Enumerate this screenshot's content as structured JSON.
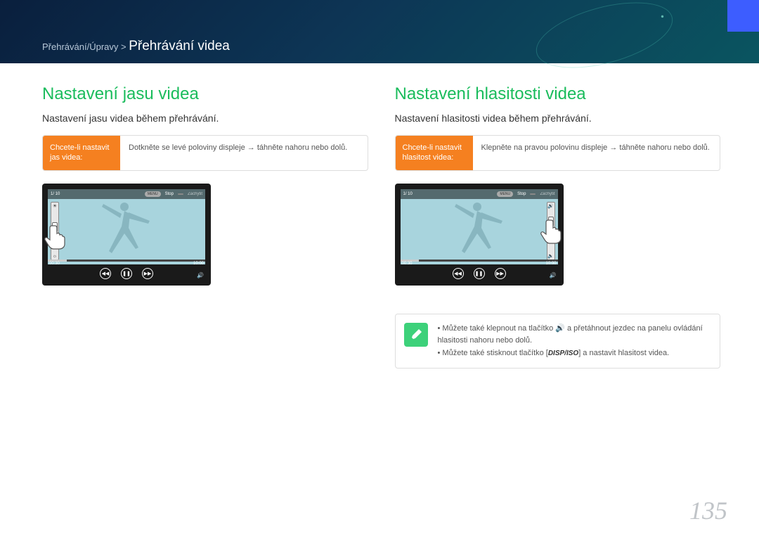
{
  "header": {
    "breadcrumb_parent": "Přehrávání/Úpravy > ",
    "breadcrumb_current": "Přehrávání videa"
  },
  "left": {
    "title": "Nastavení jasu videa",
    "subtitle": "Nastavení jasu videa během přehrávání.",
    "instr_label": "Chcete-li nastavit jas videa:",
    "instr_text": "Dotkněte se levé poloviny displeje → táhněte nahoru nebo dolů.",
    "device": {
      "counter": "1/ 10",
      "menu_btn": "MENU",
      "stop_label": "Stop",
      "capture_label": "Zachytit",
      "time_start": "00:30",
      "time_end": "10:00"
    }
  },
  "right": {
    "title": "Nastavení hlasitosti videa",
    "subtitle": "Nastavení hlasitosti videa během přehrávání.",
    "instr_label": "Chcete-li nastavit hlasitost videa:",
    "instr_text": "Klepněte na pravou polovinu displeje → táhněte nahoru nebo dolů.",
    "device": {
      "counter": "1/ 10",
      "menu_btn": "MENU",
      "stop_label": "Stop",
      "capture_label": "Zachytit",
      "time_start": "00:30",
      "time_end": "10:00"
    },
    "tips": {
      "line1_pre": "Můžete také klepnout na tlačítko ",
      "line1_post": " a přetáhnout jezdec na panelu ovládání hlasitosti nahoru nebo dolů.",
      "line2_pre": "Můžete také stisknout tlačítko [",
      "disp_label": "DISP/ISO",
      "line2_post": "] a nastavit hlasitost videa."
    }
  },
  "page_number": "135"
}
